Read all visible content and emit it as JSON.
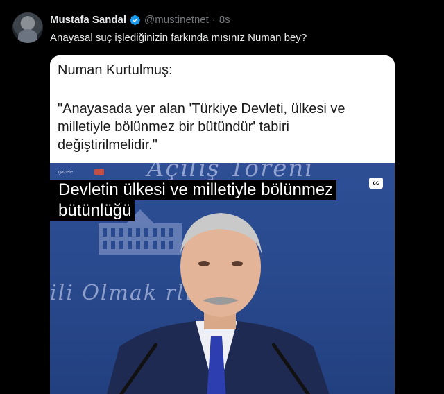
{
  "tweet": {
    "author_name": "Mustafa Sandal",
    "handle": "@mustinetnet",
    "separator": "·",
    "time": "8s",
    "text": "Anayasal suç işlediğinizin farkında mısınız Numan bey?"
  },
  "quote": {
    "author": "Numan Kurtulmuş:",
    "text": "\"Anayasada yer alan 'Türkiye Devleti, ülkesi ve milletiyle bölünmez bir bütündür' tabiri değiştirilmelidir.\""
  },
  "video": {
    "captions": [
      "Devletin ülkesi ve milletiyle bölünmez",
      "bütünlüğü"
    ],
    "cc_label": "cc",
    "channel_tag": "gazete",
    "background_text_top": "Açılış Töreni",
    "background_text_mid": "ili  Olmak  rlıktır."
  },
  "colors": {
    "background": "#000000",
    "verified_badge": "#1d9bf0",
    "muted_text": "#71767b",
    "video_bg": "#2a4a8f"
  },
  "icons": [
    "verified-badge-icon",
    "cc-icon"
  ]
}
